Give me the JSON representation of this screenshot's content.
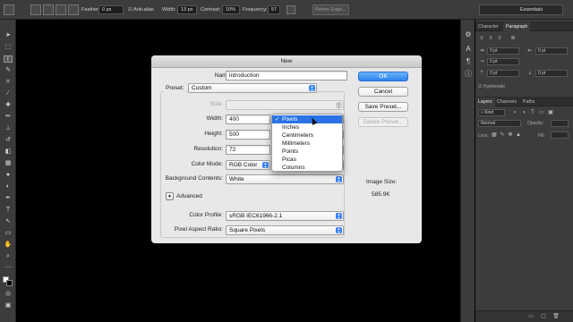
{
  "options_bar": {
    "feather_label": "Feather:",
    "feather_value": "0 px",
    "antialias_label": "Anti-alias",
    "width_label": "Width:",
    "width_value": "13 px",
    "contrast_label": "Contrast:",
    "contrast_value": "10%",
    "frequency_label": "Frequency:",
    "frequency_value": "57",
    "refine_edge": "Refine Edge...",
    "workspace": "Essentials"
  },
  "right_panels": {
    "top_tabs": [
      "Character",
      "Paragraph"
    ],
    "paragraph_fields": [
      "0 pt",
      "0 pt",
      "0 pt",
      "0 pt",
      "0 pt"
    ],
    "hyphenate_label": "Hyphenate",
    "layer_tabs": [
      "Layers",
      "Channels",
      "Paths"
    ],
    "kind_label": "Kind",
    "blend_mode": "Normal",
    "opacity_label": "Opacity:",
    "lock_label": "Lock:",
    "fill_label": "Fill:"
  },
  "dialog": {
    "title": "New",
    "name_label": "Name:",
    "name_value": "introduction",
    "preset_label": "Preset:",
    "preset_value": "Custom",
    "size_label": "Size:",
    "width_label": "Width:",
    "width_value": "400",
    "height_label": "Height:",
    "height_value": "500",
    "resolution_label": "Resolution:",
    "resolution_value": "72",
    "color_mode_label": "Color Mode:",
    "color_mode_value": "RGB Color",
    "background_label": "Background Contents:",
    "background_value": "White",
    "advanced_label": "Advanced",
    "color_profile_label": "Color Profile:",
    "color_profile_value": "sRGB IEC61966-2.1",
    "pixel_aspect_label": "Pixel Aspect Ratio:",
    "pixel_aspect_value": "Square Pixels",
    "ok_label": "OK",
    "cancel_label": "Cancel",
    "save_preset_label": "Save Preset...",
    "delete_preset_label": "Delete Preset...",
    "image_size_label": "Image Size:",
    "image_size_value": "585.9K"
  },
  "unit_menu": {
    "items": [
      "Pixels",
      "Inches",
      "Centimeters",
      "Millimeters",
      "Points",
      "Picas",
      "Columns"
    ],
    "selected": "Pixels"
  },
  "colors": {
    "accent": "#2a83f0",
    "menu_highlight": "#2a73e6",
    "app_chrome": "#3c3c3c"
  }
}
